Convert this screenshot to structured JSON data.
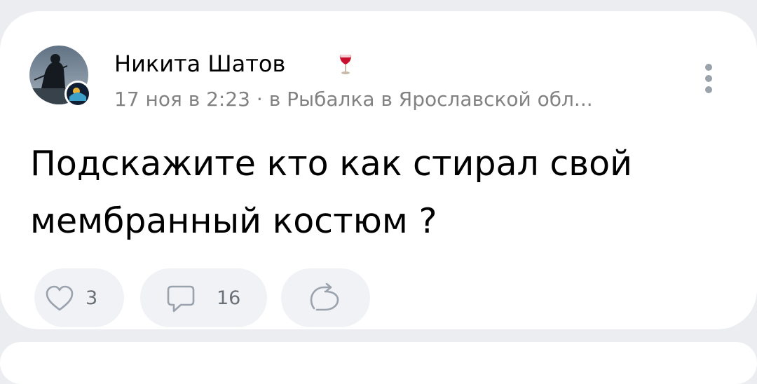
{
  "post": {
    "author_name": "Никита Шатов",
    "status_emoji": "wine-glass-icon",
    "meta": "17 ноя в 2:23 · в Рыбалка в Ярославской обл...",
    "text_line1": "Подскажите кто как стирал свой",
    "text_line2": "мембранный костюм ?"
  },
  "actions": {
    "likes_count": "3",
    "comments_count": "16"
  },
  "icons": {
    "like": "heart-icon",
    "comment": "comment-bubble-icon",
    "share": "share-arrow-icon",
    "more": "more-vertical-icon"
  },
  "colors": {
    "background": "#ebedf0",
    "card": "#ffffff",
    "meta_text": "#828282",
    "icon_gray": "#99a2ad",
    "pill_bg": "#f0f2f5"
  }
}
